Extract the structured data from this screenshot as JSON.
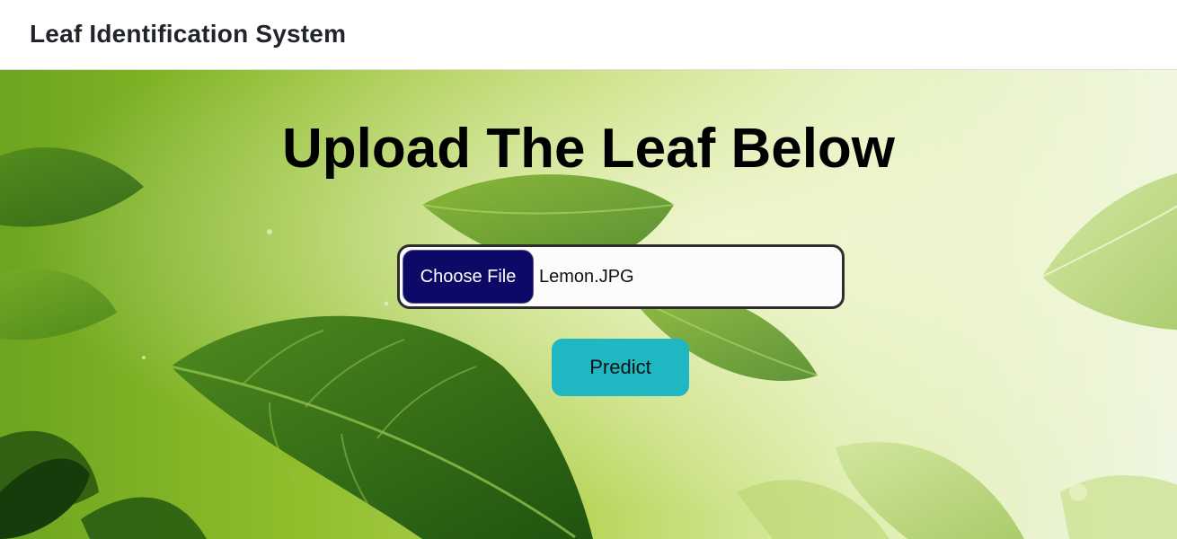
{
  "navbar": {
    "brand": "Leaf Identification System"
  },
  "main": {
    "heading": "Upload The Leaf Below",
    "file_input": {
      "button_label": "Choose File",
      "selected_file": "Lemon.JPG"
    },
    "predict_label": "Predict"
  },
  "colors": {
    "choose_button": "#0c0a66",
    "predict_button": "#1fb8c2",
    "leaf_dark": "#2f6a14",
    "leaf_light": "#9cc43a"
  },
  "background": {
    "description_icon": "green-leaves-background"
  }
}
